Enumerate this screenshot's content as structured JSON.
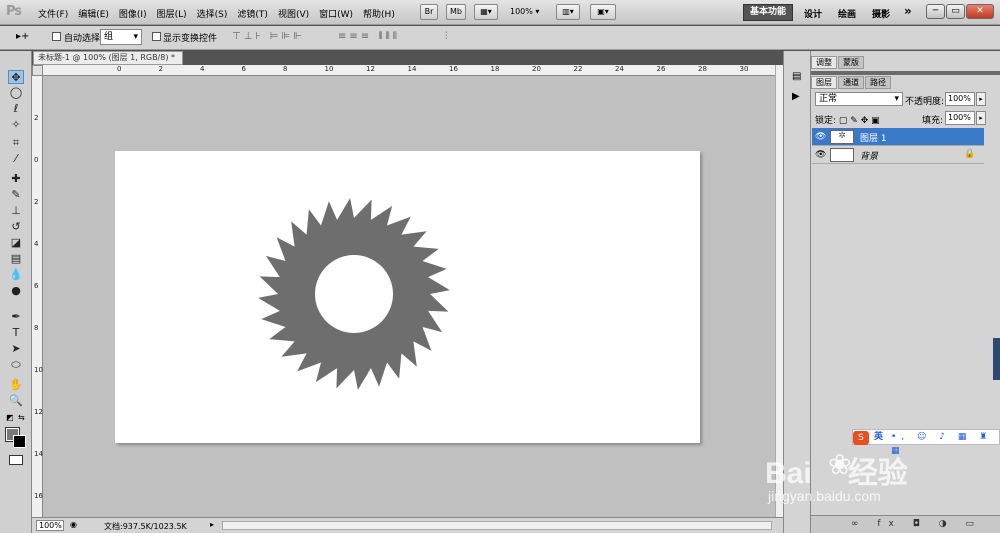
{
  "app": {
    "logo": "Ps"
  },
  "menu": [
    "文件(F)",
    "编辑(E)",
    "图像(I)",
    "图层(L)",
    "选择(S)",
    "滤镜(T)",
    "视图(V)",
    "窗口(W)",
    "帮助(H)"
  ],
  "appbar": {
    "br": "Br",
    "mb": "Mb",
    "zoom": "100%",
    "zoom_arrow": "▾"
  },
  "workspaces": {
    "active": "基本功能",
    "items": [
      "设计",
      "绘画",
      "摄影"
    ],
    "more": "»"
  },
  "window_controls": {
    "minimize": "─",
    "restore": "▭",
    "close": "✕"
  },
  "options": {
    "tool_icon": "▸+",
    "auto_select_label": "自动选择:",
    "auto_select_value": "组",
    "show_transform_label": "显示变换控件",
    "align_icons": "⊤⊥⊦ ⊨⊫⊩",
    "distribute_icons": "≡≡≡ ⫴⫴⫴",
    "auto_align_icon": "⫶"
  },
  "document": {
    "tab_title": "未标题-1 @ 100% (图层 1, RGB/8) *",
    "tab_close": "×"
  },
  "ruler_h": [
    "0",
    "2",
    "4",
    "6",
    "8",
    "10",
    "12",
    "14",
    "16",
    "18",
    "20",
    "22",
    "24",
    "26",
    "28",
    "30"
  ],
  "ruler_v": [
    "2",
    "0",
    "2",
    "4",
    "6",
    "8",
    "10",
    "12",
    "14",
    "16"
  ],
  "status": {
    "zoom": "100%",
    "doc_info": "文档:937.5K/1023.5K",
    "arrow": "▸"
  },
  "panel": {
    "top_tabs": [
      "调整",
      "蒙版"
    ],
    "tabs": [
      "图层",
      "通道",
      "路径"
    ],
    "blend_mode": "正常",
    "opacity_label": "不透明度:",
    "opacity_value": "100%",
    "lock_label": "锁定:",
    "lock_icons": "▢ ✎ ✥ ▣",
    "fill_label": "填充:",
    "fill_value": "100%",
    "layers": [
      {
        "name": "图层 1",
        "selected": true
      },
      {
        "name": "背景",
        "selected": false
      }
    ],
    "bottom_icons": "∞ fx ◘ ◑ ▭ ▣ 🗑",
    "lock_icon": "🔒",
    "eye_icon": "👁"
  },
  "ime": {
    "logo": "S",
    "lang": "英",
    "icons": "•, ☺ ♪ ▦ ♜ ▦"
  },
  "watermark": {
    "main": "Bai",
    "main2": "经验",
    "paw": "❀",
    "sub": "jingyan.baidu.com"
  },
  "colors": {
    "selected_layer": "#3a78c8",
    "canvas_bg": "#c0c0c0",
    "shape": "#6e6e6e"
  }
}
